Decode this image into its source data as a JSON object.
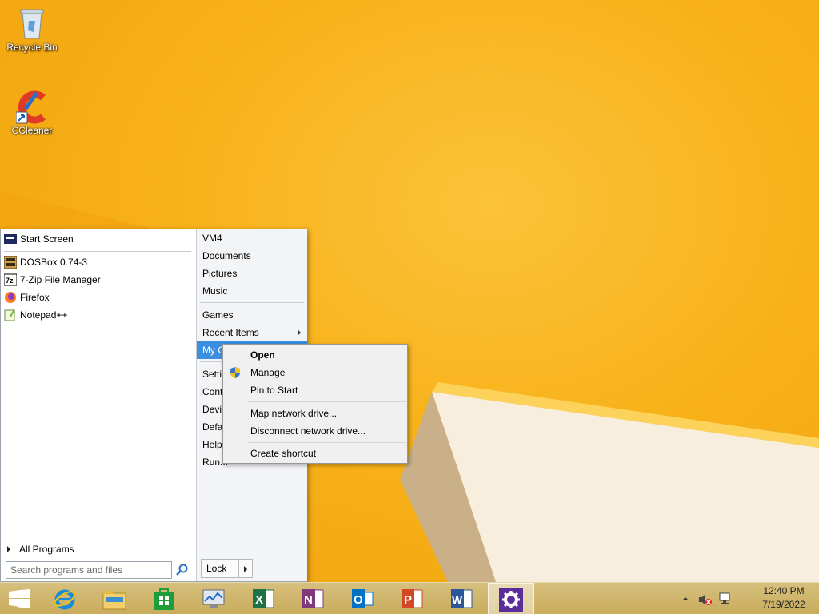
{
  "desktop": {
    "icons": [
      {
        "label": "Recycle Bin"
      },
      {
        "label": "CCleaner"
      }
    ]
  },
  "start_menu": {
    "left_items": [
      {
        "label": "Start Screen",
        "icon": "start-screen-icon"
      },
      {
        "label": "DOSBox 0.74-3",
        "icon": "dosbox-icon"
      },
      {
        "label": "7-Zip File Manager",
        "icon": "7zip-icon"
      },
      {
        "label": "Firefox",
        "icon": "firefox-icon"
      },
      {
        "label": "Notepad++",
        "icon": "notepadpp-icon"
      }
    ],
    "all_programs": "All Programs",
    "search_placeholder": "Search programs and files",
    "right_items": [
      {
        "label": "VM4"
      },
      {
        "label": "Documents"
      },
      {
        "label": "Pictures"
      },
      {
        "label": "Music"
      },
      {
        "label": "Games"
      },
      {
        "label": "Recent Items"
      },
      {
        "label": "My C"
      },
      {
        "label": "Setti"
      },
      {
        "label": "Cont"
      },
      {
        "label": "Devi"
      },
      {
        "label": "Defa"
      },
      {
        "label": "Help"
      },
      {
        "label": "Run..."
      }
    ],
    "lock_label": "Lock"
  },
  "context_menu": {
    "items": [
      {
        "label": "Open"
      },
      {
        "label": "Manage",
        "icon": "uac-shield-icon"
      },
      {
        "label": "Pin to Start"
      },
      {
        "label": "Map network drive..."
      },
      {
        "label": "Disconnect network drive..."
      },
      {
        "label": "Create shortcut"
      }
    ]
  },
  "taskbar": {
    "apps": [
      {
        "name": "Internet Explorer",
        "icon": "ie-icon"
      },
      {
        "name": "File Explorer",
        "icon": "file-explorer-icon"
      },
      {
        "name": "Store",
        "icon": "store-icon"
      },
      {
        "name": "Resource Monitor",
        "icon": "monitor-icon"
      },
      {
        "name": "Excel",
        "icon": "excel-icon",
        "letter": "X",
        "color": "#1e7145"
      },
      {
        "name": "OneNote",
        "icon": "onenote-icon",
        "letter": "N",
        "color": "#80397b"
      },
      {
        "name": "Outlook",
        "icon": "outlook-icon",
        "letter": "O",
        "color": "#0072c6"
      },
      {
        "name": "PowerPoint",
        "icon": "powerpoint-icon",
        "letter": "P",
        "color": "#d24726"
      },
      {
        "name": "Word",
        "icon": "word-icon",
        "letter": "W",
        "color": "#2b579a"
      },
      {
        "name": "Settings",
        "icon": "gear-icon",
        "active": true
      }
    ],
    "clock_time": "12:40 PM",
    "clock_date": "7/19/2022"
  },
  "colors": {
    "accent_highlight": "#3b8fe0",
    "wallpaper": "#f8b219"
  }
}
